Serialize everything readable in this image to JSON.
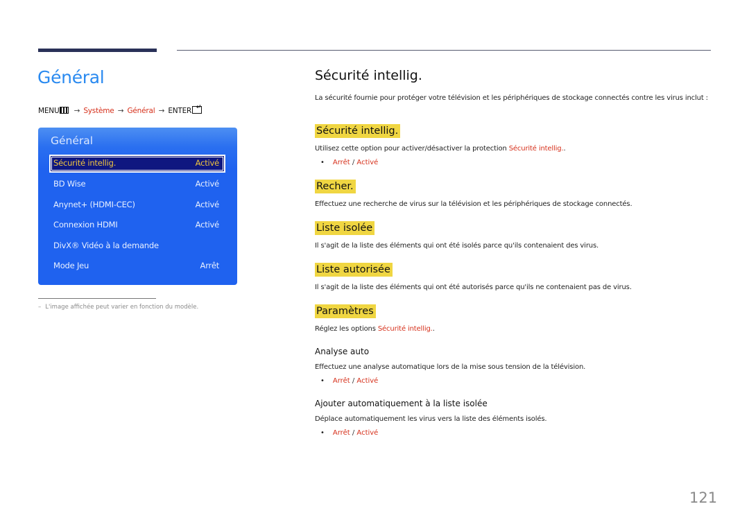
{
  "header": {
    "page_title": "Général",
    "breadcrumb": {
      "menu": "MENU",
      "menu_icon": "menu-grid-icon",
      "arrow": "→",
      "systeme": "Système",
      "general": "Général",
      "enter": "ENTER",
      "enter_icon": "enter-return-icon"
    }
  },
  "panel": {
    "title": "Général",
    "rows": [
      {
        "label": "Sécurité intellig.",
        "value": "Activé",
        "selected": true
      },
      {
        "label": "BD Wise",
        "value": "Activé"
      },
      {
        "label": "Anynet+ (HDMI-CEC)",
        "value": "Activé"
      },
      {
        "label": "Connexion HDMI",
        "value": "Activé"
      },
      {
        "label": "DivX® Vidéo à la demande",
        "value": ""
      },
      {
        "label": "Mode Jeu",
        "value": "Arrêt"
      }
    ]
  },
  "footnote": {
    "dash": "–",
    "text": "L'image affichée peut varier en fonction du modèle."
  },
  "content": {
    "title": "Sécurité intellig.",
    "intro": "La sécurité fournie pour protéger votre télévision et les périphériques de stockage connectés contre les virus inclut :",
    "sections": [
      {
        "heading": "Sécurité intellig.",
        "desc_prefix": "Utilisez cette option pour activer/désactiver la protection ",
        "desc_link": "Sécurité intellig.",
        "desc_suffix": ".",
        "options": {
          "off": "Arrêt",
          "sep": "/",
          "on": "Activé"
        }
      },
      {
        "heading": "Recher.",
        "desc": "Effectuez une recherche de virus sur la télévision et les périphériques de stockage connectés."
      },
      {
        "heading": "Liste isolée",
        "desc": "Il s'agit de la liste des éléments qui ont été isolés parce qu'ils contenaient des virus."
      },
      {
        "heading": "Liste autorisée",
        "desc": "Il s'agit de la liste des éléments qui ont été autorisés parce qu'ils ne contenaient pas de virus."
      },
      {
        "heading": "Paramètres",
        "desc_prefix": "Réglez les options ",
        "desc_link": "Sécurité intellig.",
        "desc_suffix": "."
      }
    ],
    "subsections": [
      {
        "heading": "Analyse auto",
        "desc": "Effectuez une analyse automatique lors de la mise sous tension de la télévision.",
        "options": {
          "off": "Arrêt",
          "sep": "/",
          "on": "Activé"
        }
      },
      {
        "heading": "Ajouter automatiquement à la liste isolée",
        "desc": "Déplace automatiquement les virus vers la liste des éléments isolés.",
        "options": {
          "off": "Arrêt",
          "sep": "/",
          "on": "Activé"
        }
      }
    ],
    "bullet": "•"
  },
  "page_number": "121",
  "colors": {
    "title_blue": "#2a8af0",
    "link_red": "#d6301b",
    "highlight_yellow": "#f0d642",
    "panel_blue": "#1f62ef",
    "selected_row": "#0f1780",
    "selected_text": "#f0c43e"
  }
}
